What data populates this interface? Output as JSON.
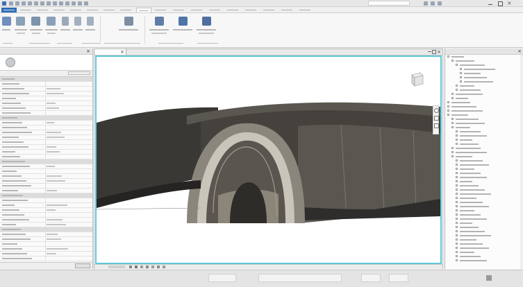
{
  "app": {
    "title": "",
    "file_name": ""
  },
  "quick_access": {
    "items": []
  },
  "ribbon": {
    "tabs": [],
    "active_tab_index": 0,
    "tools": [],
    "panels": []
  },
  "properties": {
    "title": "",
    "type_selector": {
      "family": ""
    },
    "filter": {
      "label": "",
      "edit_type_label": ""
    },
    "rows": [],
    "footer": {
      "help_link": "",
      "apply_label": ""
    }
  },
  "view": {
    "tab_title": "",
    "status_controls": []
  },
  "project_browser": {
    "title": "",
    "tree": []
  },
  "status_bar": {
    "message": "",
    "segments": []
  },
  "colors": {
    "tunnel_dark": "#3a3835",
    "tunnel_lining": "#7c7870",
    "interior": "#8a857a",
    "viewport_border": "#5cc8d8"
  }
}
